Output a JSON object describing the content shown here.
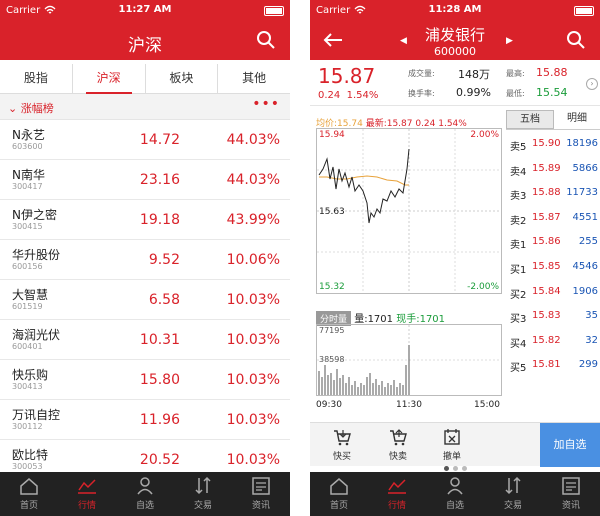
{
  "left": {
    "status": {
      "carrier": "Carrier",
      "time": "11:27 AM"
    },
    "title": "沪深",
    "tabs": [
      "股指",
      "沪深",
      "板块",
      "其他"
    ],
    "section": {
      "label": "涨幅榜",
      "more": "•••"
    },
    "stocks": [
      {
        "name": "N永艺",
        "code": "603600",
        "price": "14.72",
        "pct": "44.03%"
      },
      {
        "name": "N南华",
        "code": "300417",
        "price": "23.16",
        "pct": "44.03%"
      },
      {
        "name": "N伊之密",
        "code": "300415",
        "price": "19.18",
        "pct": "43.99%"
      },
      {
        "name": "华升股份",
        "code": "600156",
        "price": "9.52",
        "pct": "10.06%"
      },
      {
        "name": "大智慧",
        "code": "601519",
        "price": "6.58",
        "pct": "10.03%"
      },
      {
        "name": "海润光伏",
        "code": "600401",
        "price": "10.31",
        "pct": "10.03%"
      },
      {
        "name": "快乐购",
        "code": "300413",
        "price": "15.80",
        "pct": "10.03%"
      },
      {
        "name": "万讯自控",
        "code": "300112",
        "price": "11.96",
        "pct": "10.03%"
      },
      {
        "name": "欧比特",
        "code": "300053",
        "price": "20.52",
        "pct": "10.03%"
      }
    ]
  },
  "right": {
    "status": {
      "carrier": "Carrier",
      "time": "11:28 AM"
    },
    "stock_name": "浦发银行",
    "stock_code": "600000",
    "price": "15.87",
    "change": "0.24",
    "change_pct": "1.54%",
    "stats": {
      "vol_label": "成交量:",
      "vol": "148万",
      "turn_label": "换手率:",
      "turn": "0.99%",
      "high_label": "最高:",
      "high": "15.88",
      "low_label": "最低:",
      "low": "15.54"
    },
    "avg_line": {
      "avg": "均价:15.74",
      "latest": "最新:15.87 0.24 1.54%"
    },
    "chart": {
      "top_left": "15.94",
      "top_right": "2.00%",
      "mid_left": "15.63",
      "bottom_left": "15.32",
      "bottom_right": "-2.00%"
    },
    "volume": {
      "btn": "分时量",
      "vol": "量:1701",
      "now": "现手:1701",
      "max": "77195",
      "mid": "38598"
    },
    "time_axis": [
      "09:30",
      "11:30",
      "15:00"
    ],
    "order_tabs": [
      "五档",
      "明细"
    ],
    "orders": [
      {
        "label": "卖5",
        "price": "15.90",
        "qty": "18196",
        "color": "red"
      },
      {
        "label": "卖4",
        "price": "15.89",
        "qty": "5866",
        "color": "red"
      },
      {
        "label": "卖3",
        "price": "15.88",
        "qty": "11733",
        "color": "red"
      },
      {
        "label": "卖2",
        "price": "15.87",
        "qty": "4551",
        "color": "red"
      },
      {
        "label": "卖1",
        "price": "15.86",
        "qty": "255",
        "color": "red"
      },
      {
        "label": "买1",
        "price": "15.85",
        "qty": "4546",
        "color": "red"
      },
      {
        "label": "买2",
        "price": "15.84",
        "qty": "1906",
        "color": "red"
      },
      {
        "label": "买3",
        "price": "15.83",
        "qty": "35",
        "color": "red"
      },
      {
        "label": "买4",
        "price": "15.82",
        "qty": "32",
        "color": "red"
      },
      {
        "label": "买5",
        "price": "15.81",
        "qty": "299",
        "color": "red"
      }
    ],
    "actions": [
      "快买",
      "快卖",
      "撤单"
    ],
    "add_watch": "加自选"
  },
  "tabbar": [
    "首页",
    "行情",
    "自选",
    "交易",
    "资讯"
  ],
  "icons": [
    "search-icon",
    "back-icon",
    "home-icon",
    "chart-icon",
    "person-icon",
    "trade-icon",
    "news-icon"
  ],
  "colors": {
    "brand": "#d9222a",
    "up": "#d9222a",
    "down": "#1a9c3a",
    "accent": "#4a90e2"
  }
}
